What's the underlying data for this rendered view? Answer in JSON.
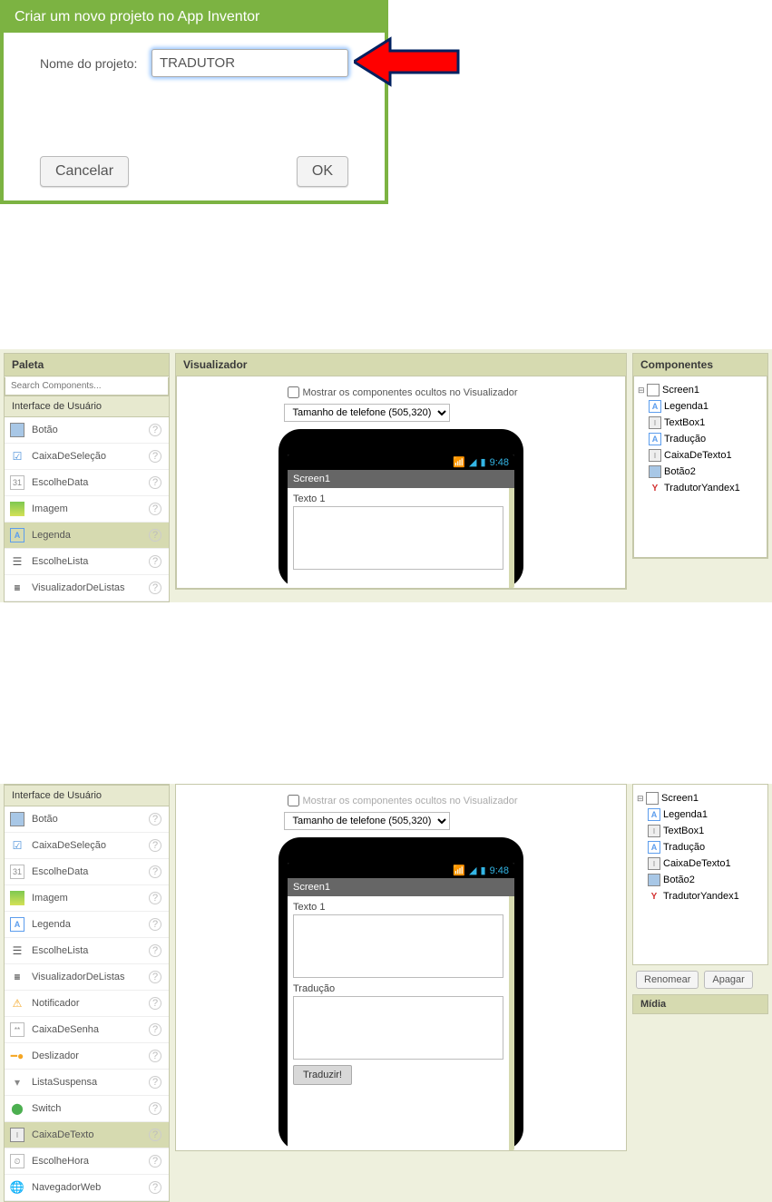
{
  "dialog": {
    "title": "Criar um novo projeto no App Inventor",
    "label": "Nome do projeto:",
    "value": "TRADUTOR",
    "cancel": "Cancelar",
    "ok": "OK"
  },
  "palette": {
    "title": "Paleta",
    "search_placeholder": "Search Components...",
    "category": "Interface de Usuário",
    "items_a": [
      {
        "label": "Botão"
      },
      {
        "label": "CaixaDeSeleção"
      },
      {
        "label": "EscolheData"
      },
      {
        "label": "Imagem"
      },
      {
        "label": "Legenda"
      },
      {
        "label": "EscolheLista"
      },
      {
        "label": "VisualizadorDeListas"
      }
    ],
    "items_b": [
      {
        "label": "Botão"
      },
      {
        "label": "CaixaDeSeleção"
      },
      {
        "label": "EscolheData"
      },
      {
        "label": "Imagem"
      },
      {
        "label": "Legenda"
      },
      {
        "label": "EscolheLista"
      },
      {
        "label": "VisualizadorDeListas"
      },
      {
        "label": "Notificador"
      },
      {
        "label": "CaixaDeSenha"
      },
      {
        "label": "Deslizador"
      },
      {
        "label": "ListaSuspensa"
      },
      {
        "label": "Switch"
      },
      {
        "label": "CaixaDeTexto"
      },
      {
        "label": "EscolheHora"
      },
      {
        "label": "NavegadorWeb"
      }
    ]
  },
  "viewer": {
    "title": "Visualizador",
    "hidden_label": "Mostrar os componentes ocultos no Visualizador",
    "size_options": [
      "Tamanho de telefone (505,320)"
    ],
    "size_selected": "Tamanho de telefone (505,320)",
    "phone": {
      "time": "9:48",
      "screen_title": "Screen1",
      "text1": "Texto 1",
      "traducao": "Tradução",
      "traduzir": "Traduzir!"
    }
  },
  "components": {
    "title": "Componentes",
    "tree": [
      {
        "label": "Screen1",
        "icon": "screen",
        "depth": 0,
        "toggle": "⊟"
      },
      {
        "label": "Legenda1",
        "icon": "label",
        "depth": 1
      },
      {
        "label": "TextBox1",
        "icon": "text",
        "depth": 1
      },
      {
        "label": "Tradução",
        "icon": "label",
        "depth": 1
      },
      {
        "label": "CaixaDeTexto1",
        "icon": "text",
        "depth": 1
      },
      {
        "label": "Botão2",
        "icon": "button",
        "depth": 1
      },
      {
        "label": "TradutorYandex1",
        "icon": "yandex",
        "depth": 1
      }
    ],
    "rename": "Renomear",
    "delete": "Apagar",
    "media": "Mídia"
  }
}
